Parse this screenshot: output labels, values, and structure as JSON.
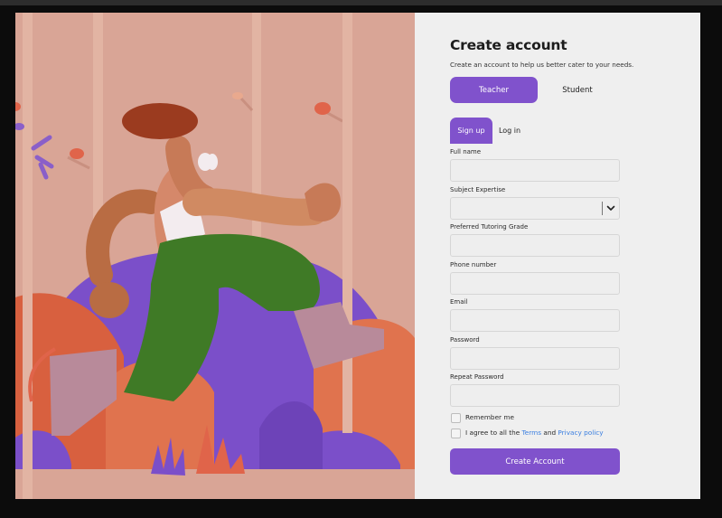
{
  "header": {
    "title": "Create account",
    "subtitle": "Create an account to help us better cater to your needs."
  },
  "roles": {
    "teacher": "Teacher",
    "student": "Student",
    "selected": "Teacher"
  },
  "auth_tabs": {
    "signup": "Sign up",
    "login": "Log in",
    "active": "Sign up"
  },
  "form": {
    "full_name_label": "Full name",
    "subject_label": "Subject Expertise",
    "grade_label": "Preferred Tutoring Grade",
    "phone_label": "Phone number",
    "email_label": "Email",
    "password_label": "Password",
    "repeat_password_label": "Repeat Password",
    "remember_me": "Remember me",
    "agree_prefix": "I agree to all the",
    "terms_link": "Terms",
    "agree_and": "and",
    "privacy_link": "Privacy policy",
    "submit_label": "Create Account"
  },
  "colors": {
    "accent": "#8052cc",
    "link": "#3a7ee0",
    "panel_bg": "#efefef",
    "illustration_bg": "#d9a596"
  },
  "icons": {
    "dropdown": "chevron-down-icon"
  }
}
